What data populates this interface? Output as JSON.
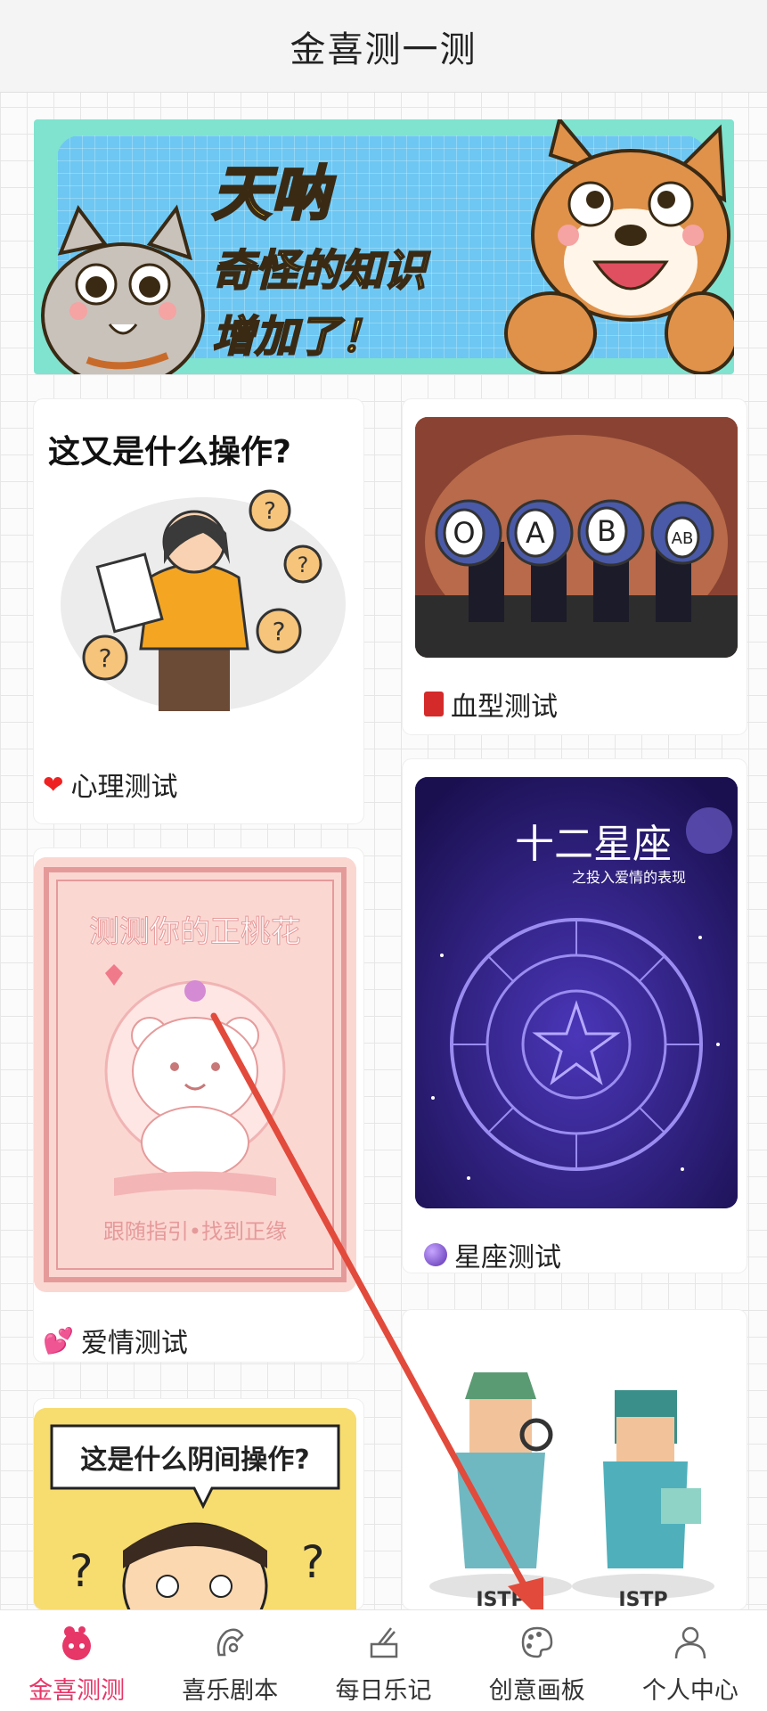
{
  "header": {
    "title": "金喜测一测"
  },
  "banner": {
    "line1": "天呐",
    "line2": "奇怪的知识",
    "line3": "增加了！"
  },
  "cards": {
    "psych": {
      "heading": "这又是什么操作?",
      "label": "心理测试",
      "icon": "heart-icon"
    },
    "blood": {
      "label": "血型测试",
      "icon": "red-book-icon",
      "ball1": "O",
      "ball2": "A",
      "ball3": "B",
      "ball4": "AB"
    },
    "love": {
      "headline": "测测你的正桃花",
      "footer": "跟随指引•找到正缘",
      "label": "爱情测试",
      "icon": "two-hearts-icon"
    },
    "zodiac": {
      "headline": "十二星座",
      "sub": "之投入爱情的表现",
      "label": "星座测试",
      "icon": "crystal-ball-icon"
    },
    "yin": {
      "headline": "这是什么阴间操作?"
    },
    "mbti": {
      "text1": "ISTP",
      "text2": "ISTP"
    }
  },
  "tabs": [
    {
      "label": "金喜测测",
      "icon": "test-icon",
      "active": true
    },
    {
      "label": "喜乐剧本",
      "icon": "script-icon",
      "active": false
    },
    {
      "label": "每日乐记",
      "icon": "journal-icon",
      "active": false
    },
    {
      "label": "创意画板",
      "icon": "palette-icon",
      "active": false
    },
    {
      "label": "个人中心",
      "icon": "person-icon",
      "active": false
    }
  ],
  "colors": {
    "accent": "#e73668",
    "arrow": "#e24a3b"
  }
}
